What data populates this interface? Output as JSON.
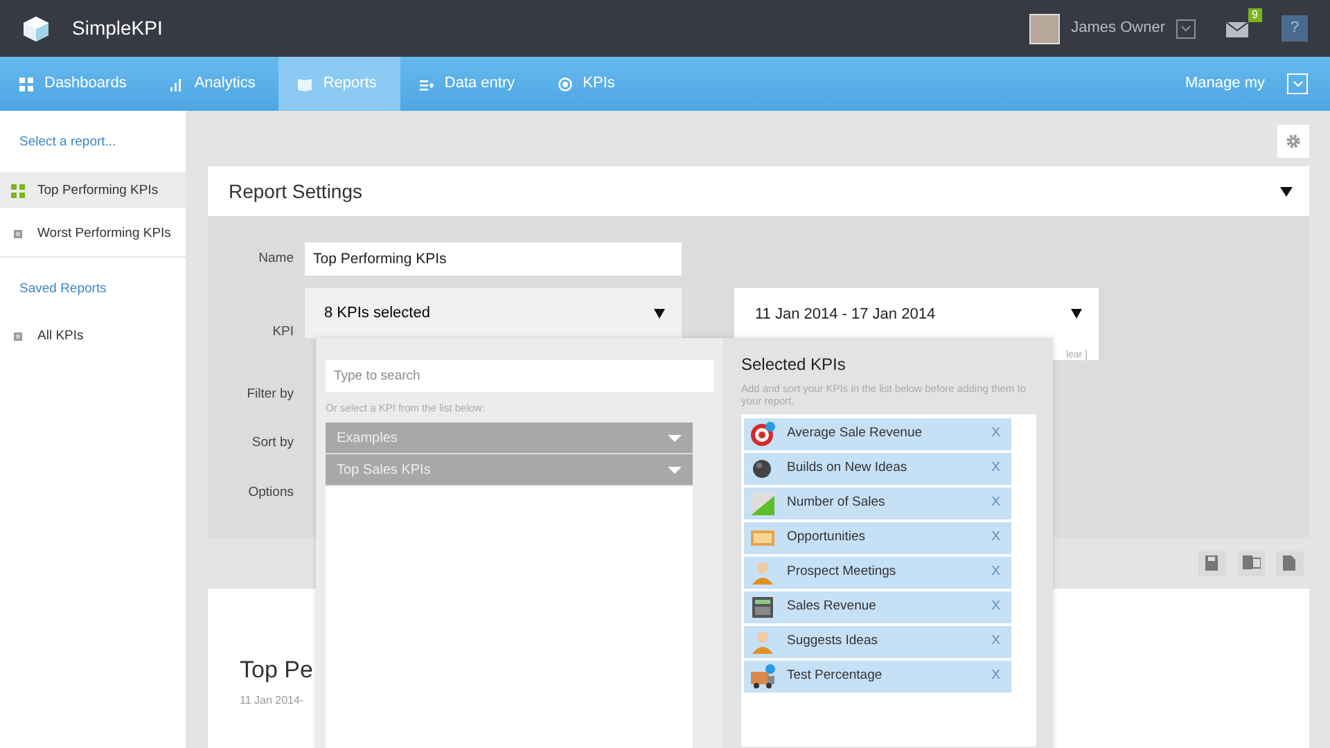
{
  "app": {
    "title": "SimpleKPI"
  },
  "user": {
    "name": "James Owner",
    "messages_badge": "9",
    "help": "?"
  },
  "nav": {
    "items": [
      {
        "label": "Dashboards",
        "selected": false
      },
      {
        "label": "Analytics",
        "selected": false
      },
      {
        "label": "Reports",
        "selected": true
      },
      {
        "label": "Data entry",
        "selected": false
      },
      {
        "label": "KPIs",
        "selected": false
      }
    ],
    "right_label": "Manage my"
  },
  "sidebar": {
    "header": "Select a report...",
    "reports": [
      {
        "label": "Top Performing KPIs",
        "selected": true
      },
      {
        "label": "Worst Performing KPIs",
        "selected": false
      }
    ],
    "saved_header": "Saved Reports",
    "saved": [
      {
        "label": "All KPIs",
        "selected": false
      }
    ]
  },
  "report_settings": {
    "title": "Report Settings",
    "labels": [
      "Name",
      "KPI",
      "Filter by",
      "Sort by",
      "Options"
    ],
    "name_value": "Top Performing KPIs",
    "kpi_value": "8 KPIs selected",
    "date_range": "11 Jan 2014 - 17 Jan 2014",
    "date_note": "lear ]"
  },
  "kpi_picker": {
    "search_placeholder": "Type to search",
    "hint": "Or select a KPI from the list below:",
    "groups": [
      "Examples",
      "Top Sales KPIs"
    ],
    "selected_title": "Selected KPIs",
    "selected_hint": "Add and sort your KPIs in the list below before adding them to your report.",
    "selected": [
      {
        "label": "Average Sale Revenue",
        "remove": "X"
      },
      {
        "label": "Builds on New Ideas",
        "remove": "X"
      },
      {
        "label": "Number of Sales",
        "remove": "X"
      },
      {
        "label": "Opportunities",
        "remove": "X"
      },
      {
        "label": "Prospect Meetings",
        "remove": "X"
      },
      {
        "label": "Sales Revenue",
        "remove": "X"
      },
      {
        "label": "Suggests Ideas",
        "remove": "X"
      },
      {
        "label": "Test Percentage",
        "remove": "X"
      }
    ]
  },
  "report_preview": {
    "title": "Top Pe",
    "date": "11 Jan 2014-"
  }
}
